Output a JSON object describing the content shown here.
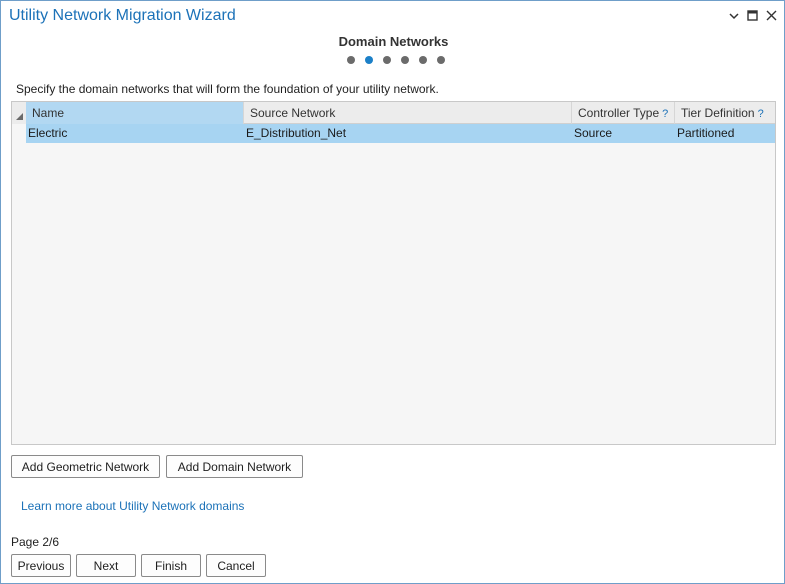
{
  "window": {
    "title": "Utility Network Migration Wizard",
    "dropdown_icon": "chevron-down-icon",
    "maximize_icon": "maximize-icon",
    "close_icon": "close-icon"
  },
  "step": {
    "title": "Domain Networks",
    "dots": [
      {
        "state": "inactive"
      },
      {
        "state": "active"
      },
      {
        "state": "inactive"
      },
      {
        "state": "inactive"
      },
      {
        "state": "inactive"
      },
      {
        "state": "inactive"
      }
    ]
  },
  "instructions": "Specify the domain networks that will form the foundation of your utility network.",
  "grid": {
    "columns": {
      "name": "Name",
      "source": "Source Network",
      "ctrl": "Controller Type",
      "tier": "Tier Definition",
      "help": "?"
    },
    "rows": [
      {
        "name": "Electric",
        "source": "E_Distribution_Net",
        "ctrl": "Source",
        "tier": "Partitioned"
      }
    ]
  },
  "buttons": {
    "add_geometric": "Add Geometric Network",
    "add_domain": "Add Domain Network",
    "previous": "Previous",
    "next": "Next",
    "finish": "Finish",
    "cancel": "Cancel"
  },
  "learn_more": "Learn more about Utility Network domains",
  "page_indicator": "Page 2/6",
  "colors": {
    "accent": "#1c72b8",
    "selected_row": "#a7d4f2",
    "active_dot": "#1c80c8"
  }
}
